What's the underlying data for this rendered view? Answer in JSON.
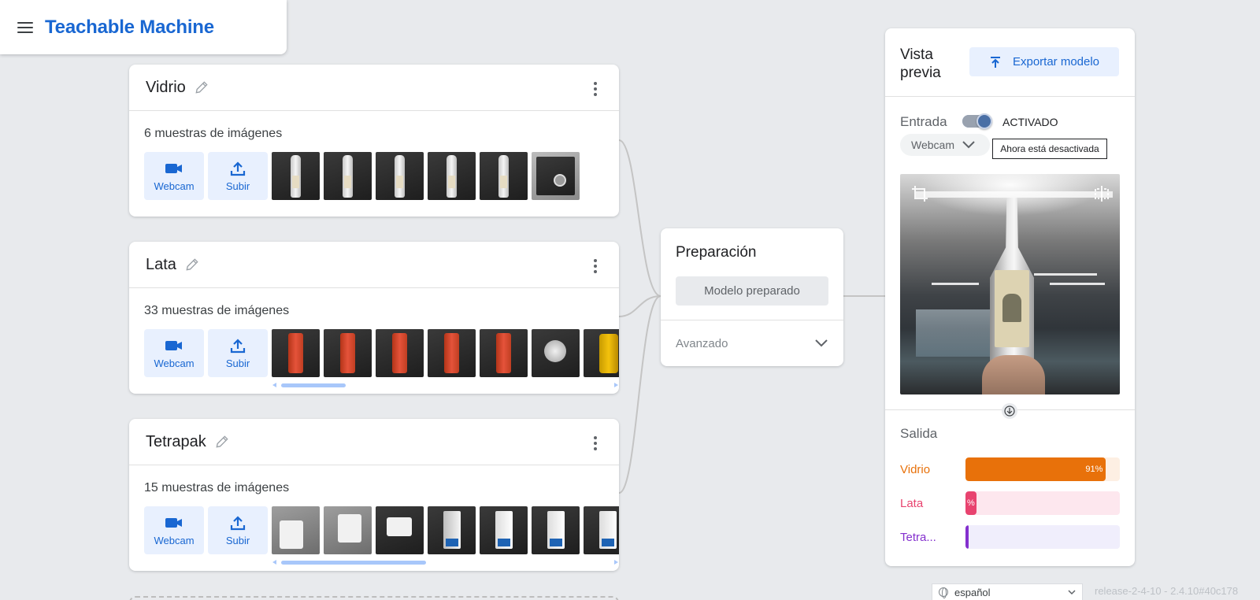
{
  "app": {
    "title": "Teachable Machine"
  },
  "classes": [
    {
      "name": "Vidrio",
      "sample_count": "6 muestras de imágenes",
      "webcam_label": "Webcam",
      "upload_label": "Subir"
    },
    {
      "name": "Lata",
      "sample_count": "33 muestras de imágenes",
      "webcam_label": "Webcam",
      "upload_label": "Subir"
    },
    {
      "name": "Tetrapak",
      "sample_count": "15 muestras de imágenes",
      "webcam_label": "Webcam",
      "upload_label": "Subir"
    }
  ],
  "training": {
    "title": "Preparación",
    "button_label": "Modelo preparado",
    "advanced_label": "Avanzado"
  },
  "preview": {
    "title": "Vista previa",
    "export_label": "Exportar modelo",
    "input_label": "Entrada",
    "toggle_state": "ACTIVADO",
    "source_label": "Webcam",
    "tooltip": "Ahora está desactivada",
    "output_label": "Salida",
    "outputs": [
      {
        "name": "Vidrio",
        "percent": 91,
        "percent_text": "91%",
        "color": "#e8710a",
        "track": "#fdefe3"
      },
      {
        "name": "Lata",
        "percent": 7,
        "percent_text": "%",
        "color": "#e52592",
        "track": "#fde7ee"
      },
      {
        "name": "Tetra...",
        "percent": 2,
        "percent_text": "",
        "color": "#9334e6",
        "track": "#f0eefc"
      }
    ]
  },
  "footer": {
    "language": "español",
    "version": "release-2-4-10 - 2.4.10#40c178"
  },
  "icons": [
    "menu-icon",
    "pencil-icon",
    "more-vert-icon",
    "webcam-icon",
    "upload-icon",
    "export-icon",
    "chevron-down-icon",
    "arrow-down-icon",
    "globe-icon",
    "crop-icon",
    "flip-icon"
  ],
  "colors": {
    "brand": "#1967d2",
    "accent_light": "#e8f0fe",
    "background": "#e8eaed"
  }
}
